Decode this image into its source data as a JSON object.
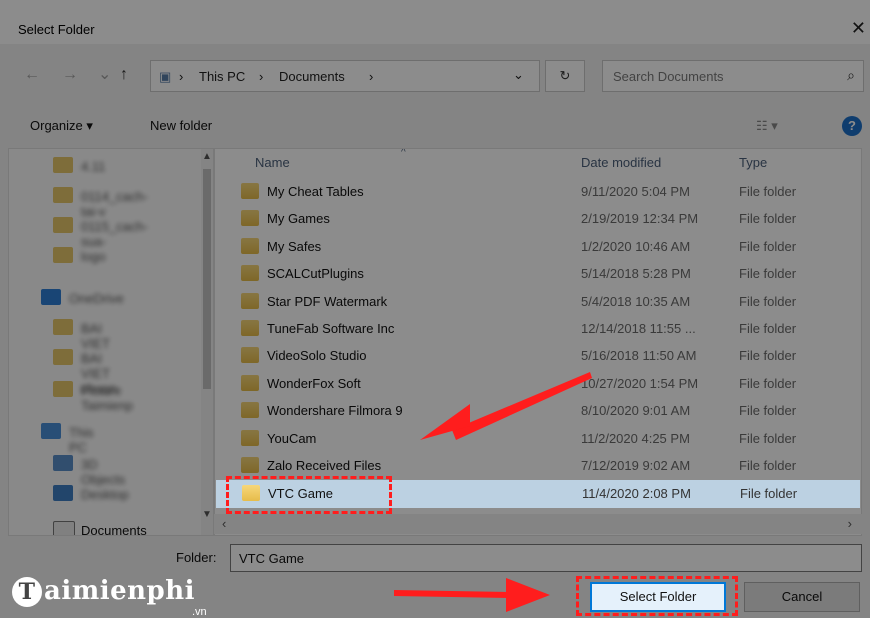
{
  "window": {
    "title": "Select Folder",
    "close_icon": "close-icon"
  },
  "nav": {
    "back_icon": "←",
    "forward_icon": "→",
    "history_icon": "⌄",
    "up_icon": "↑",
    "breadcrumbs": [
      "This PC",
      "Documents"
    ],
    "search_placeholder": "Search Documents"
  },
  "toolbar": {
    "organize_label": "Organize ▾",
    "new_folder_label": "New folder",
    "help_label": "?"
  },
  "sidebar": {
    "items": [
      "4.11",
      "0114_cach-tai-v",
      "0115_cach-sua-",
      "logo",
      "OneDrive",
      "BAI VIET",
      "BAI VIET chuan",
      "Picture Taimienp",
      "This PC",
      "3D Objects",
      "Desktop",
      "Documents"
    ]
  },
  "columns": {
    "name": "Name",
    "date": "Date modified",
    "type": "Type"
  },
  "files": [
    {
      "name": "My Cheat Tables",
      "date": "9/11/2020 5:04 PM",
      "type": "File folder"
    },
    {
      "name": "My Games",
      "date": "2/19/2019 12:34 PM",
      "type": "File folder"
    },
    {
      "name": "My Safes",
      "date": "1/2/2020 10:46 AM",
      "type": "File folder"
    },
    {
      "name": "SCALCutPlugins",
      "date": "5/14/2018 5:28 PM",
      "type": "File folder"
    },
    {
      "name": "Star PDF Watermark",
      "date": "5/4/2018 10:35 AM",
      "type": "File folder"
    },
    {
      "name": "TuneFab Software Inc",
      "date": "12/14/2018 11:55 ...",
      "type": "File folder"
    },
    {
      "name": "VideoSolo Studio",
      "date": "5/16/2018 11:50 AM",
      "type": "File folder"
    },
    {
      "name": "WonderFox Soft",
      "date": "10/27/2020 1:54 PM",
      "type": "File folder"
    },
    {
      "name": "Wondershare Filmora 9",
      "date": "8/10/2020 9:01 AM",
      "type": "File folder"
    },
    {
      "name": "YouCam",
      "date": "11/2/2020 4:25 PM",
      "type": "File folder"
    },
    {
      "name": "Zalo Received Files",
      "date": "7/12/2019 9:02 AM",
      "type": "File folder"
    },
    {
      "name": "VTC Game",
      "date": "11/4/2020 2:08 PM",
      "type": "File folder",
      "selected": true
    }
  ],
  "folder_field": {
    "label": "Folder:",
    "value": "VTC Game"
  },
  "buttons": {
    "select": "Select Folder",
    "cancel": "Cancel"
  },
  "watermark": {
    "brand": "aimienphi",
    "brand_initial": "T",
    "suffix": ".vn"
  },
  "colors": {
    "highlight_red": "#ff1d1d",
    "selection_blue": "#cce8ff"
  }
}
